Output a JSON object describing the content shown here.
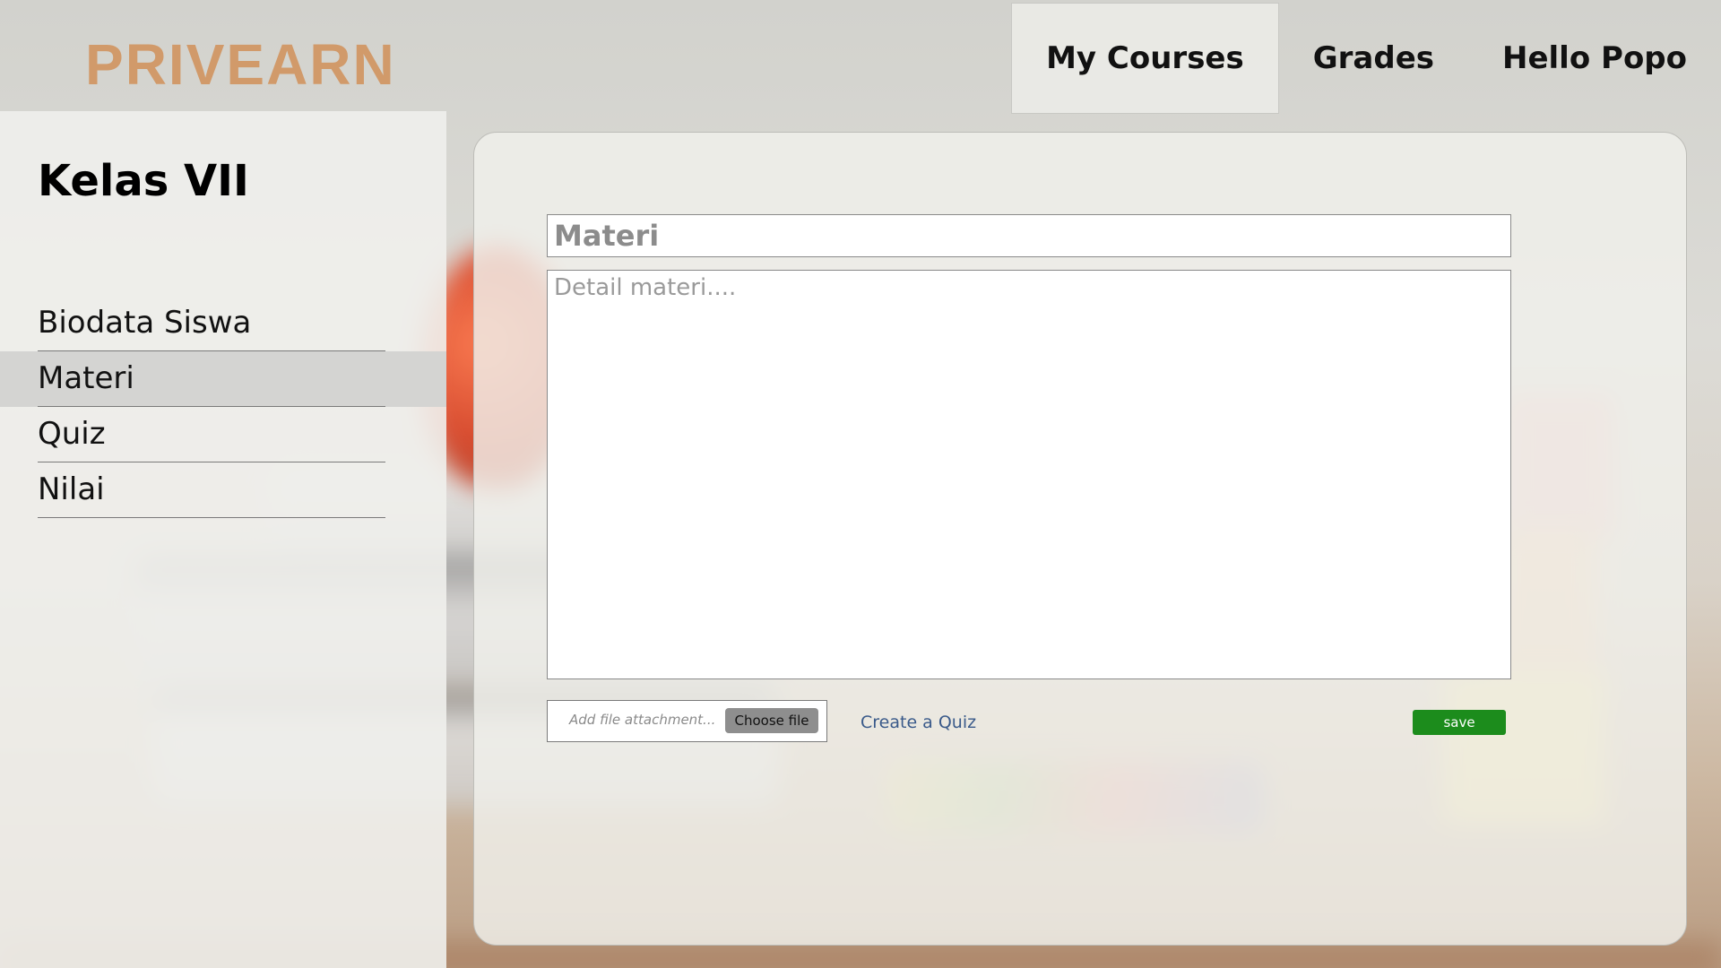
{
  "header": {
    "logo": "PRIVEARN",
    "nav": [
      {
        "label": "My Courses",
        "active": true
      },
      {
        "label": "Grades",
        "active": false
      },
      {
        "label": "Hello Popo",
        "active": false
      }
    ]
  },
  "sidebar": {
    "title": "Kelas VII",
    "items": [
      {
        "label": "Biodata Siswa",
        "active": false
      },
      {
        "label": "Materi",
        "active": true
      },
      {
        "label": "Quiz",
        "active": false
      },
      {
        "label": "Nilai",
        "active": false
      }
    ]
  },
  "form": {
    "title_placeholder": "Materi",
    "title_value": "",
    "detail_placeholder": "Detail materi....",
    "detail_value": "",
    "file_placeholder": "Add file attachment...",
    "choose_file_label": "Choose file",
    "create_quiz_label": "Create a Quiz",
    "save_label": "save"
  },
  "colors": {
    "logo": "#d19a6a",
    "save_button": "#1c8c1c",
    "link": "#3a5a8a",
    "active_sidebar": "#d4d4d2"
  }
}
